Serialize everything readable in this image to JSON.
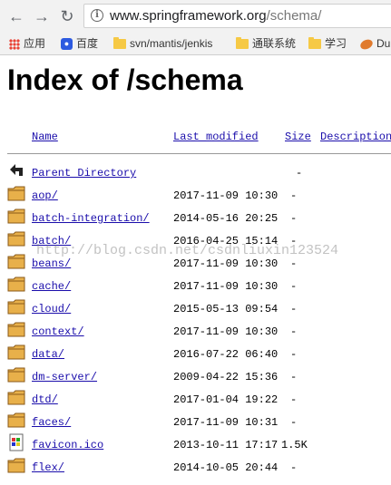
{
  "browser": {
    "url_host": "www.springframework.org",
    "url_path": "/schema/",
    "bookmarks": [
      "应用",
      "百度",
      "svn/mantis/jenkis",
      "通联系统",
      "学习",
      "Du"
    ]
  },
  "page": {
    "title": "Index of /schema",
    "columns": {
      "name": "Name",
      "modified": "Last modified",
      "size": "Size",
      "description": "Description"
    },
    "parent": {
      "name": "Parent Directory",
      "size": "-"
    },
    "rows": [
      {
        "type": "folder",
        "name": "aop/",
        "modified": "2017-11-09 10:30",
        "size": "-"
      },
      {
        "type": "folder",
        "name": "batch-integration/",
        "modified": "2014-05-16 20:25",
        "size": "-"
      },
      {
        "type": "folder",
        "name": "batch/",
        "modified": "2016-04-25 15:14",
        "size": "-"
      },
      {
        "type": "folder",
        "name": "beans/",
        "modified": "2017-11-09 10:30",
        "size": "-"
      },
      {
        "type": "folder",
        "name": "cache/",
        "modified": "2017-11-09 10:30",
        "size": "-"
      },
      {
        "type": "folder",
        "name": "cloud/",
        "modified": "2015-05-13 09:54",
        "size": "-"
      },
      {
        "type": "folder",
        "name": "context/",
        "modified": "2017-11-09 10:30",
        "size": "-"
      },
      {
        "type": "folder",
        "name": "data/",
        "modified": "2016-07-22 06:40",
        "size": "-"
      },
      {
        "type": "folder",
        "name": "dm-server/",
        "modified": "2009-04-22 15:36",
        "size": "-"
      },
      {
        "type": "folder",
        "name": "dtd/",
        "modified": "2017-01-04 19:22",
        "size": "-"
      },
      {
        "type": "folder",
        "name": "faces/",
        "modified": "2017-11-09 10:31",
        "size": "-"
      },
      {
        "type": "file",
        "name": "favicon.ico",
        "modified": "2013-10-11 17:17",
        "size": "1.5K"
      },
      {
        "type": "folder",
        "name": "flex/",
        "modified": "2014-10-05 20:44",
        "size": "-"
      }
    ]
  },
  "watermark": "http://blog.csdn.net/csdnliuxin123524"
}
